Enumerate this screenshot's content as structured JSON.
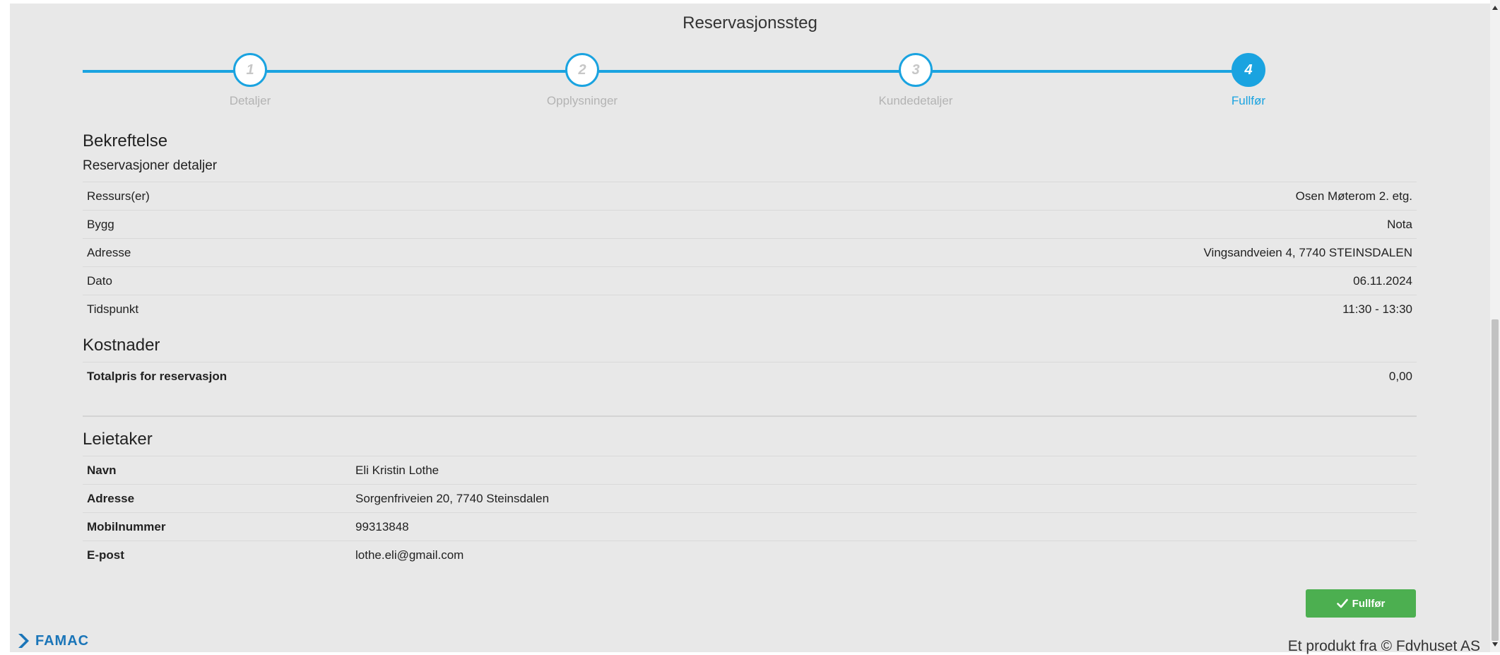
{
  "header": {
    "title": "Reservasjonssteg"
  },
  "steps": [
    {
      "number": "1",
      "label": "Detaljer",
      "active": false
    },
    {
      "number": "2",
      "label": "Opplysninger",
      "active": false
    },
    {
      "number": "3",
      "label": "Kundedetaljer",
      "active": false
    },
    {
      "number": "4",
      "label": "Fullfør",
      "active": true
    }
  ],
  "confirmation": {
    "title": "Bekreftelse",
    "subtitle": "Reservasjoner detaljer",
    "rows": [
      {
        "label": "Ressurs(er)",
        "value": "Osen Møterom 2. etg."
      },
      {
        "label": "Bygg",
        "value": "Nota"
      },
      {
        "label": "Adresse",
        "value": "Vingsandveien 4, 7740 STEINSDALEN"
      },
      {
        "label": "Dato",
        "value": "06.11.2024"
      },
      {
        "label": "Tidspunkt",
        "value": "11:30 - 13:30"
      }
    ]
  },
  "costs": {
    "title": "Kostnader",
    "total_label": "Totalpris for reservasjon",
    "total_value": "0,00"
  },
  "tenant": {
    "title": "Leietaker",
    "rows": [
      {
        "label": "Navn",
        "value": "Eli Kristin Lothe"
      },
      {
        "label": "Adresse",
        "value": "Sorgenfriveien 20, 7740 Steinsdalen"
      },
      {
        "label": "Mobilnummer",
        "value": "99313848"
      },
      {
        "label": "E-post",
        "value": "lothe.eli@gmail.com"
      }
    ]
  },
  "actions": {
    "finish_label": "Fullfør"
  },
  "footer": {
    "logo_text": "FAMAC",
    "copyright": "Et produkt fra © Fdvhuset AS"
  },
  "colors": {
    "accent": "#1aa3e0",
    "success": "#4caf50",
    "background": "#e8e8e8"
  }
}
